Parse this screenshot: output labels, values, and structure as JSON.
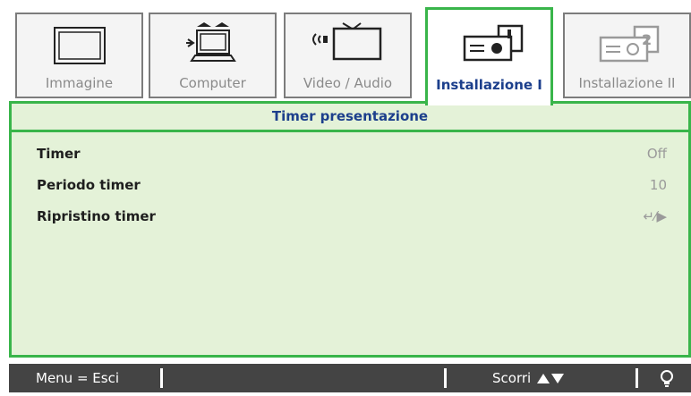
{
  "tabs": [
    {
      "label": "Immagine",
      "icon": "monitor-icon",
      "active": false
    },
    {
      "label": "Computer",
      "icon": "laptop-icon",
      "active": false
    },
    {
      "label": "Video / Audio",
      "icon": "video-audio-icon",
      "active": false
    },
    {
      "label": "Installazione I",
      "icon": "projector-icon",
      "active": true
    },
    {
      "label": "Installazione II",
      "icon": "projector-settings-icon",
      "active": false
    }
  ],
  "panel": {
    "title": "Timer presentazione",
    "items": [
      {
        "label": "Timer",
        "value": "Off"
      },
      {
        "label": "Periodo timer",
        "value": "10"
      },
      {
        "label": "Ripristino timer",
        "value": "↵⁄▶"
      }
    ]
  },
  "footer": {
    "menu": "Menu = Esci",
    "scroll": "Scorri",
    "scroll_icon": "up-down-arrows-icon",
    "help_icon": "lightbulb-icon"
  },
  "colors": {
    "accent_green": "#39b54a",
    "panel_bg": "#e4f2d8",
    "title_blue": "#1c3f8c",
    "footer_bg": "#444444"
  }
}
